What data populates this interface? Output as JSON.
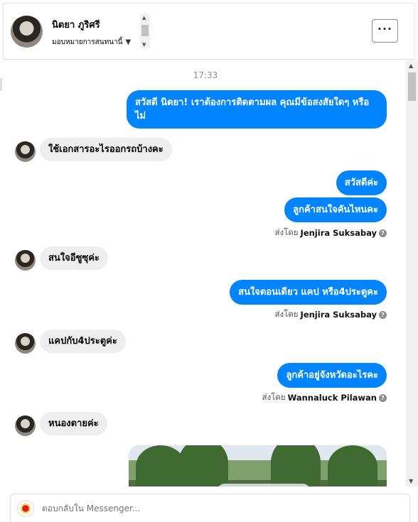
{
  "header": {
    "contact_name": "นิตยา ภูริศรี",
    "assign_label": "มอบหมายการสนทนานี้",
    "more_label": "···"
  },
  "chat": {
    "timestamp": "17:33",
    "messages": [
      {
        "dir": "out",
        "text": "สวัสดี นิตยา! เราต้องการติดตามผล คุณมีข้อสงสัยใดๆ หรือไม่"
      },
      {
        "dir": "in",
        "text": "ใช้เอกสารอะไรออกรถบ้างคะ"
      },
      {
        "dir": "out",
        "text": "สวัสดีค่ะ"
      },
      {
        "dir": "out",
        "text": "ลูกค้าสนใจคันไหนคะ"
      },
      {
        "dir": "in",
        "text": "สนใจอีซูซุค่ะ"
      },
      {
        "dir": "out",
        "text": "สนใจตอนเดียว แคป หรือ4ประตูคะ"
      },
      {
        "dir": "in",
        "text": "แคปกับ4ประตูค่ะ"
      },
      {
        "dir": "out",
        "text": "ลูกค้าอยู่จังหวัดอะไรคะ"
      },
      {
        "dir": "in",
        "text": "หนองตายค่ะ"
      }
    ],
    "sent_by_prefix": "ส่งโดย",
    "sent_by": [
      "Jenjira Suksabay",
      "Jenjira Suksabay",
      "Wannaluck Pilawan"
    ],
    "info_glyph": "?"
  },
  "reply": {
    "placeholder": "ตอบกลับใน Messenger..."
  },
  "icons": {
    "more": "ellipsis-icon",
    "caret": "caret-down-icon",
    "info": "info-icon"
  },
  "colors": {
    "outgoing_bubble": "#0084ff",
    "incoming_bubble": "#eeeeef"
  }
}
